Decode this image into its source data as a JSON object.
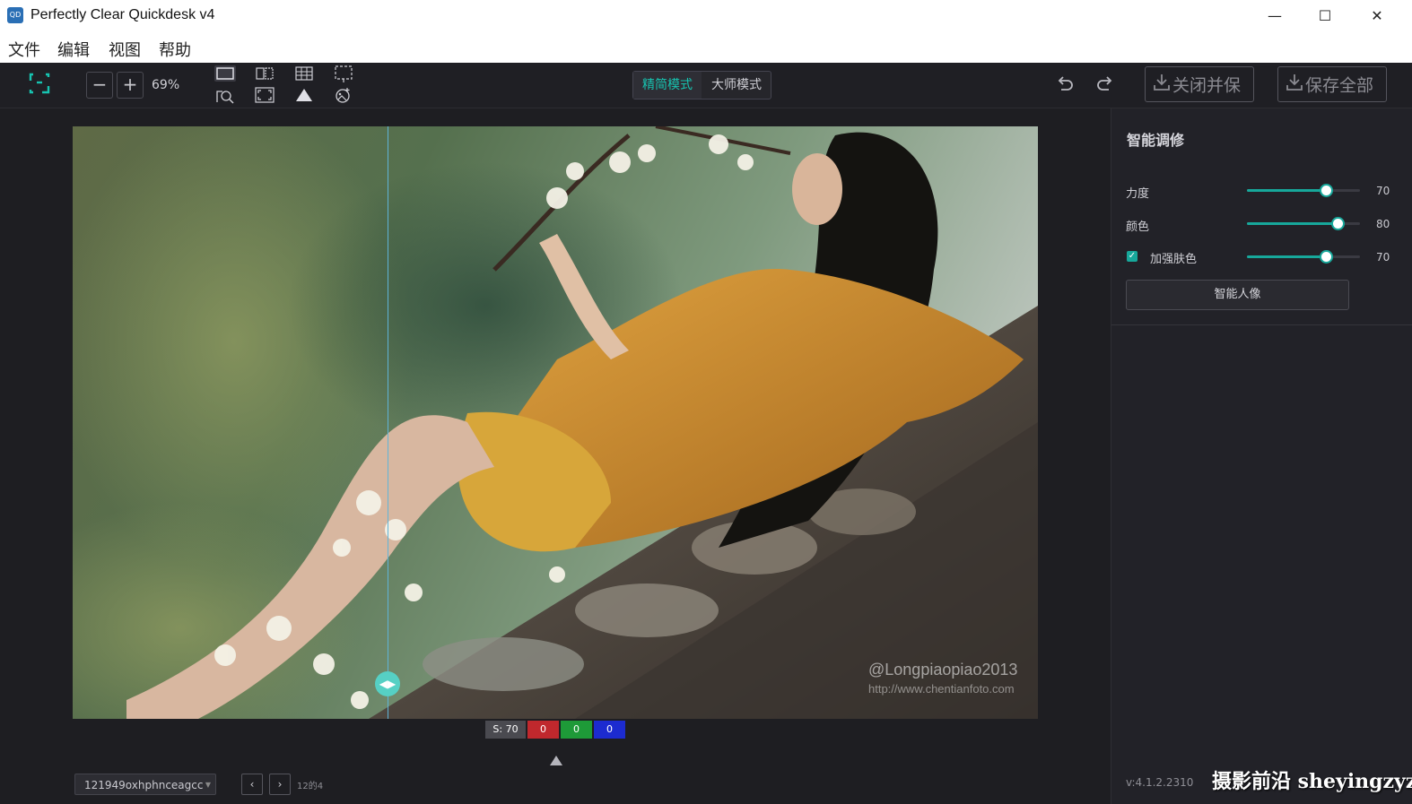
{
  "window": {
    "title": "Perfectly Clear Quickdesk v4",
    "app_icon_text": "QD",
    "minimize_icon": "minimize-icon",
    "maximize_icon": "maximize-icon",
    "close_icon": "close-icon"
  },
  "menu": {
    "items": [
      {
        "label": "文件"
      },
      {
        "label": "编辑"
      },
      {
        "label": "视图"
      },
      {
        "label": "帮助"
      }
    ]
  },
  "toolbar": {
    "zoom_level": "69%",
    "mode_simple": "精简模式",
    "mode_master": "大师模式",
    "active_mode": "精简模式",
    "close_and_save": "关闭并保",
    "save_all": "保存全部",
    "accent_color": "#17a89b"
  },
  "photo": {
    "watermark_handle": "@Longpiaopiao2013",
    "watermark_url": "http://www.chentianfoto.com"
  },
  "stats": {
    "s": "S: 70",
    "r": "0",
    "g": "0",
    "b": "0"
  },
  "panel": {
    "title": "智能调修",
    "sliders": [
      {
        "label": "力度",
        "value": "70",
        "level": 0.7
      },
      {
        "label": "颜色",
        "value": "80",
        "level": 0.8
      },
      {
        "label": "加强肤色",
        "value": "70",
        "level": 0.7,
        "checked": true
      }
    ],
    "smart_portrait_button": "智能人像",
    "version": "v:4.1.2.2310",
    "site_mark": "摄影前沿 sheyingzyz.com"
  },
  "bottom": {
    "file_name": "121949oxhphnceagcc",
    "page_info": "12的4"
  }
}
